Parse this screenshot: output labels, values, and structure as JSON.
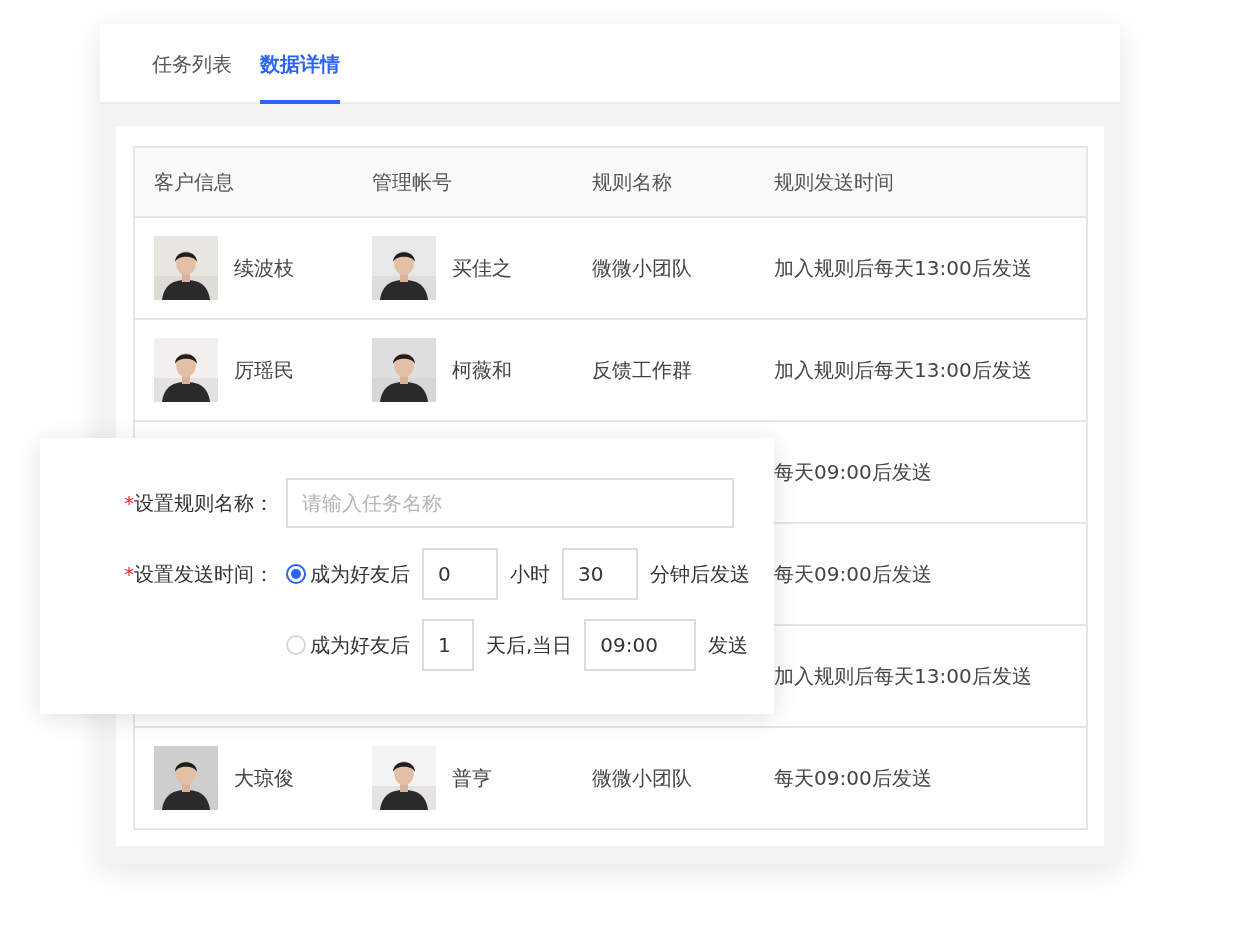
{
  "tabs": [
    {
      "label": "任务列表",
      "selected": false
    },
    {
      "label": "数据详情",
      "selected": true
    }
  ],
  "table": {
    "columns": [
      "客户信息",
      "管理帐号",
      "规则名称",
      "规则发送时间"
    ],
    "rows": [
      {
        "customer": "续波枝",
        "account": "买佳之",
        "rule": "微微小团队",
        "send_time": "加入规则后每天13:00后发送"
      },
      {
        "customer": "厉瑶民",
        "account": "柯薇和",
        "rule": "反馈工作群",
        "send_time": "加入规则后每天13:00后发送"
      },
      {
        "send_time": "每天09:00后发送"
      },
      {
        "send_time": "每天09:00后发送"
      },
      {
        "send_time": "加入规则后每天13:00后发送"
      },
      {
        "customer": "大琼俊",
        "account": "普亨",
        "rule": "微微小团队",
        "send_time": "每天09:00后发送"
      }
    ]
  },
  "rule_form": {
    "name_field": {
      "required_mark": "*",
      "label": "设置规则名称：",
      "placeholder": "请输入任务名称"
    },
    "time_field": {
      "required_mark": "*",
      "label": "设置发送时间：",
      "options": [
        {
          "selected": true,
          "parts": [
            {
              "kind": "text",
              "text": "成为好友后"
            },
            {
              "kind": "input",
              "value": "0"
            },
            {
              "kind": "text",
              "text": "小时"
            },
            {
              "kind": "input",
              "value": "30"
            },
            {
              "kind": "text",
              "text": "分钟后发送"
            }
          ]
        },
        {
          "selected": false,
          "parts": [
            {
              "kind": "text",
              "text": "成为好友后"
            },
            {
              "kind": "small-input",
              "value": "1"
            },
            {
              "kind": "text",
              "text": "天后,当日"
            },
            {
              "kind": "time-input",
              "value": "09:00"
            },
            {
              "kind": "text",
              "text": "发送"
            }
          ]
        }
      ]
    }
  }
}
